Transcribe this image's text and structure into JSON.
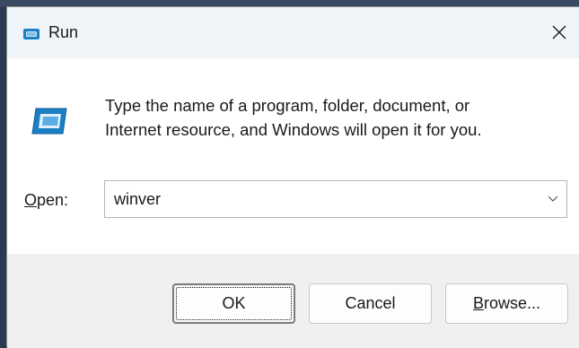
{
  "window": {
    "title": "Run",
    "title_icon": "run-icon"
  },
  "titlebar": {
    "close_icon": "close-icon"
  },
  "content": {
    "icon": "run-icon",
    "description_line1": "Type the name of a program, folder, document, or",
    "description_line2": "Internet resource, and Windows will open it for you.",
    "open_label_accel": "O",
    "open_label_rest": "pen:",
    "combo_value": "winver",
    "combo_arrow_icon": "chevron-down-icon"
  },
  "buttons": {
    "ok_label": "OK",
    "cancel_label": "Cancel",
    "browse_accel": "B",
    "browse_rest": "rowse..."
  },
  "colors": {
    "titlebar_bg": "#eff4f9",
    "content_bg": "#ffffff",
    "footer_bg": "#f0f0f0",
    "icon_blue": "#1b7fc4"
  }
}
